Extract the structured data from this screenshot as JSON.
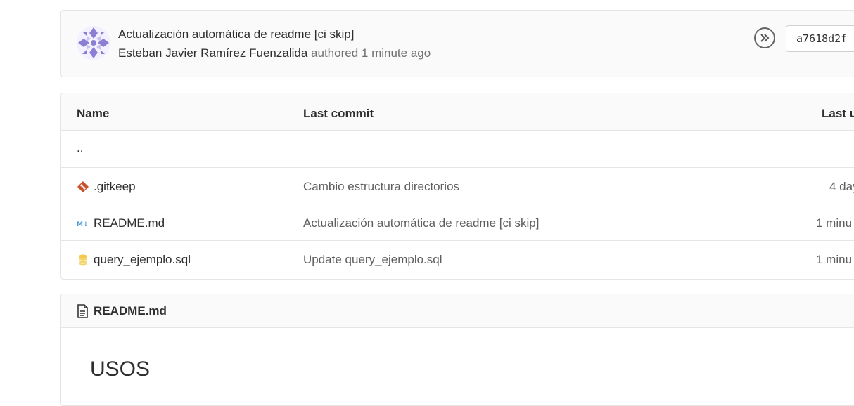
{
  "commit": {
    "title": "Actualización automática de readme [ci skip]",
    "author": "Esteban Javier Ramírez Fuenzalida",
    "action": "authored",
    "time": "1 minute ago",
    "sha": "a7618d2f"
  },
  "table": {
    "headers": {
      "name": "Name",
      "last_commit": "Last commit",
      "last_update": "Last u"
    },
    "parent": "..",
    "rows": [
      {
        "name": ".gitkeep",
        "icon": "git-icon",
        "commit": "Cambio estructura directorios",
        "date": "4 day"
      },
      {
        "name": "README.md",
        "icon": "markdown-icon",
        "commit": "Actualización automática de readme [ci skip]",
        "date": "1 minu"
      },
      {
        "name": "query_ejemplo.sql",
        "icon": "database-icon",
        "commit": "Update query_ejemplo.sql",
        "date": "1 minu"
      }
    ]
  },
  "readme": {
    "filename": "README.md",
    "heading": "USOS"
  },
  "colors": {
    "git_icon": "#e24329",
    "markdown_icon": "#4a9ad6",
    "database_icon": "#f2c94c",
    "avatar": "#8b7fd4"
  }
}
